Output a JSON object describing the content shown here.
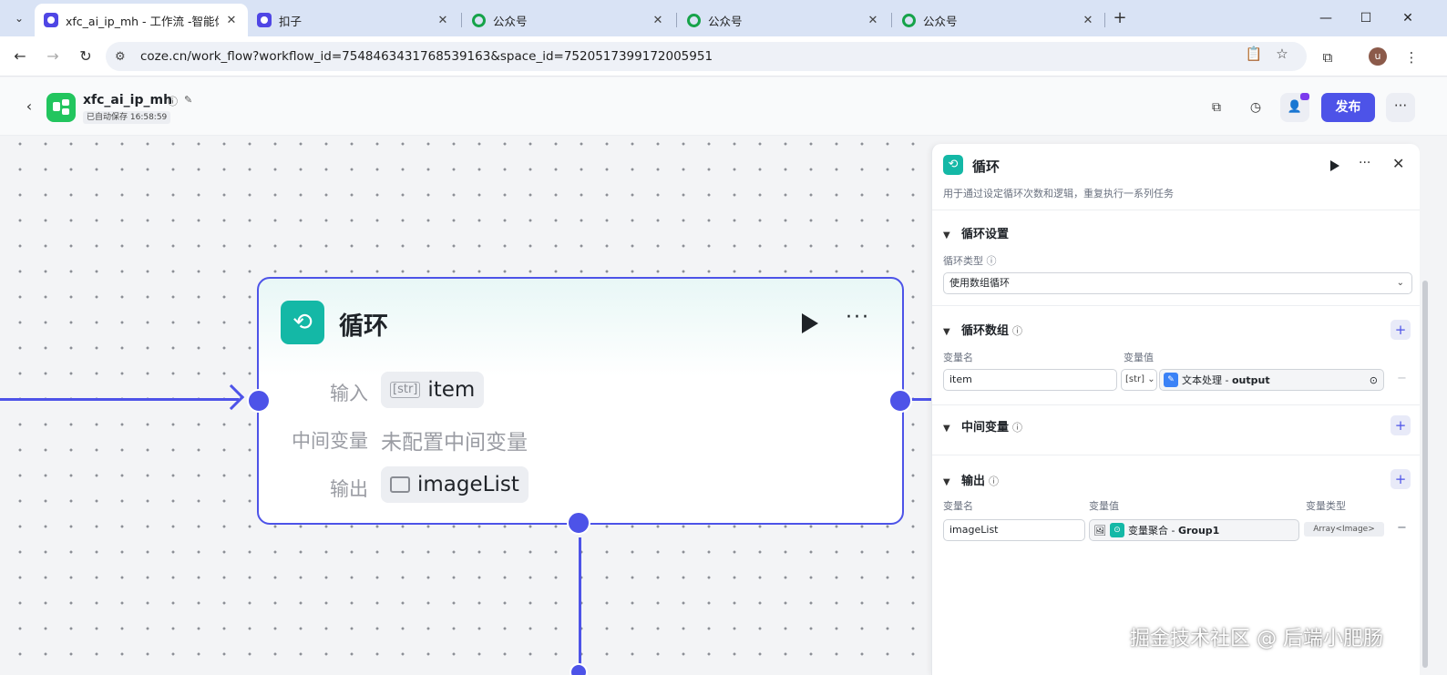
{
  "browser": {
    "tabs": [
      {
        "title": "xfc_ai_ip_mh - 工作流 -智能体",
        "icon": "coze-icon",
        "active": true
      },
      {
        "title": "扣子",
        "icon": "coze-icon",
        "active": false
      },
      {
        "title": "公众号",
        "icon": "wechat-icon",
        "active": false
      },
      {
        "title": "公众号",
        "icon": "wechat-icon",
        "active": false
      },
      {
        "title": "公众号",
        "icon": "wechat-icon",
        "active": false
      }
    ],
    "close_glyph": "✕",
    "new_tab_glyph": "+",
    "url": "coze.cn/work_flow?workflow_id=7548463431768539163&space_id=7520517399172005951",
    "profile_initial": "u"
  },
  "app": {
    "name": "xfc_ai_ip_mh",
    "autosave": "已自动保存 16:58:59",
    "publish_label": "发布",
    "more_glyph": "···",
    "accent": "#4d53e8"
  },
  "node": {
    "title": "循环",
    "input_label": "输入",
    "input_type": "[str]",
    "input_value": "item",
    "intermediate_label": "中间变量",
    "intermediate_value": "未配置中间变量",
    "output_label": "输出",
    "output_value": "imageList",
    "more_glyph": "···",
    "accent": "#14b8a6"
  },
  "panel": {
    "title": "循环",
    "description": "用于通过设定循环次数和逻辑，重复执行一系列任务",
    "more_glyph": "···",
    "close_glyph": "✕",
    "loop_settings": {
      "title": "循环设置",
      "type_label": "循环类型",
      "type_value": "使用数组循环"
    },
    "loop_array": {
      "title": "循环数组",
      "col_name": "变量名",
      "col_value": "变量值",
      "row_name": "item",
      "row_type": "[str]",
      "row_source_node": "文本处理",
      "row_source_sep": " - ",
      "row_source_field": "output"
    },
    "intermediate": {
      "title": "中间变量"
    },
    "output": {
      "title": "输出",
      "col_name": "变量名",
      "col_value": "变量值",
      "col_type": "变量类型",
      "row_name": "imageList",
      "row_source_node": "变量聚合",
      "row_source_sep": " - ",
      "row_source_field": "Group1",
      "row_type": "Array<Image>"
    },
    "add_glyph": "+",
    "remove_glyph": "−"
  },
  "watermark": "掘金技术社区 @ 后端小肥肠"
}
